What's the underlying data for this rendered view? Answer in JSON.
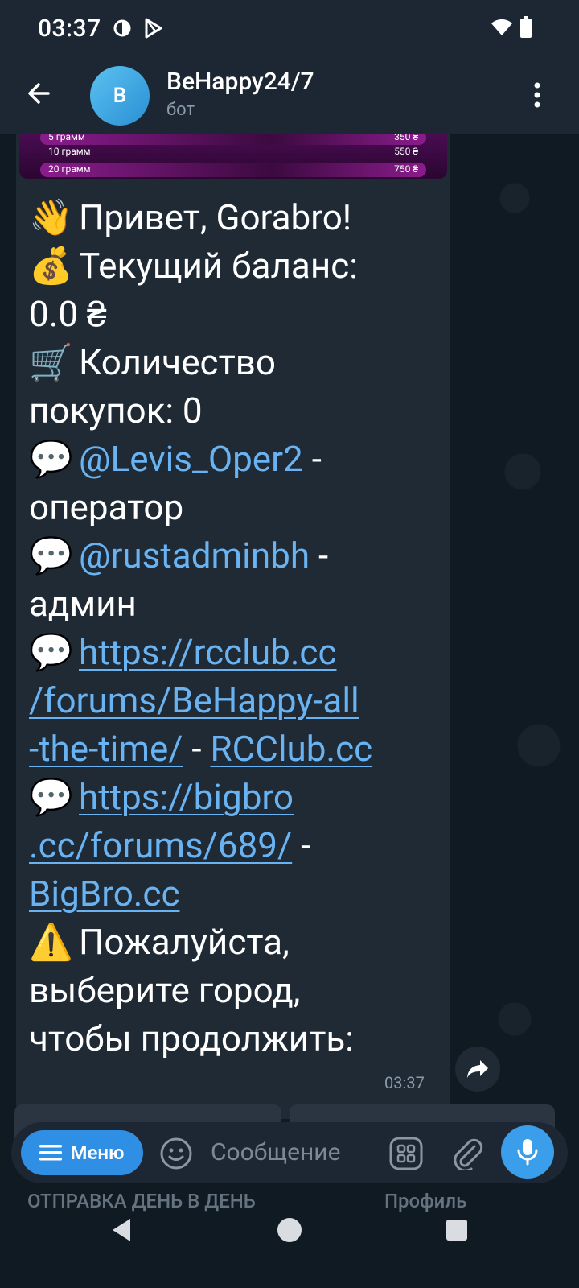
{
  "status": {
    "time": "03:37"
  },
  "header": {
    "avatar_letter": "B",
    "title": "BeHappy24/7",
    "subtitle": "бот"
  },
  "promo": {
    "rows": [
      {
        "weight": "5 грамм",
        "price": "350 ₴"
      },
      {
        "weight": "10 грамм",
        "price": "550 ₴"
      },
      {
        "weight": "20 грамм",
        "price": "750 ₴"
      }
    ]
  },
  "message": {
    "greeting": "Привет, Gorabro!",
    "balance_label": "Текущий баланс:",
    "balance_value": "0.0 ₴",
    "purchases_label": "Количество",
    "purchases_value": "покупок: 0",
    "operator_mention": "@Levis_Oper2",
    "operator_dash": " -",
    "operator_role": "оператор",
    "admin_mention": "@rustadminbh",
    "admin_dash": " -",
    "admin_role": "админ",
    "link1_part1": "https://rcclub.cc",
    "link1_part2": "/forums/BeHappy-all",
    "link1_part3": "-the-time/",
    "link1_sep": " - ",
    "link1_label": "RCClub.cc",
    "link2_part1": "https://bigbro",
    "link2_part2": ".cc/forums/689/",
    "link2_sep": " -",
    "link2_label": "BigBro.cc",
    "prompt1": "Пожалуйста,",
    "prompt2": "выберите город,",
    "prompt3": "чтобы продолжить:",
    "time": "03:37"
  },
  "emojis": {
    "wave": "👋",
    "money": "💰",
    "cart": "🛒",
    "speech": "💬",
    "warning": "⚠️"
  },
  "keyboard": {
    "left_button": "ОТПРАВКА ДЕНЬ В ДЕНЬ",
    "right_button": "Профиль"
  },
  "input": {
    "menu_label": "Меню",
    "placeholder": "Сообщение"
  },
  "colors": {
    "accent": "#3a9eeb",
    "link": "#6ab3f3",
    "bubble": "#1f2a35",
    "header": "#1d2733"
  }
}
